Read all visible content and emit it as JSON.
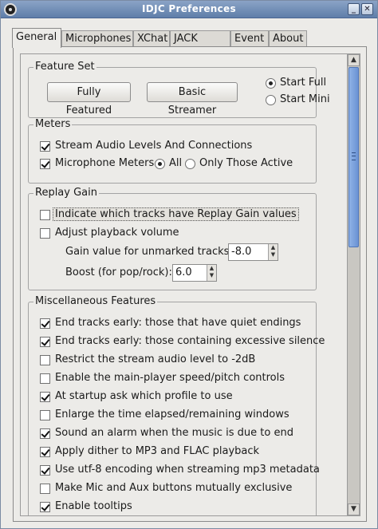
{
  "window": {
    "title": "IDJC Preferences"
  },
  "tabs": [
    {
      "label": "General",
      "active": true
    },
    {
      "label": "Microphones"
    },
    {
      "label": "XChat"
    },
    {
      "label": "JACK Ports"
    },
    {
      "label": "Event"
    },
    {
      "label": "About"
    }
  ],
  "feature_set": {
    "title": "Feature Set",
    "fully_featured": "Fully Featured",
    "basic_streamer": "Basic Streamer",
    "start_full": "Start Full",
    "start_mini": "Start Mini",
    "selected": "Start Full"
  },
  "meters": {
    "title": "Meters",
    "stream_levels": "Stream Audio Levels And Connections",
    "mic_meters": "Microphone Meters",
    "all": "All",
    "only_active": "Only Those Active"
  },
  "replay_gain": {
    "title": "Replay Gain",
    "indicate": "Indicate which tracks have Replay Gain values",
    "adjust": "Adjust playback volume",
    "gain_label": "Gain value for unmarked tracks:",
    "gain_value": "-8.0",
    "boost_label": "Boost (for pop/rock):",
    "boost_value": "6.0"
  },
  "misc": {
    "title": "Miscellaneous Features",
    "items": [
      {
        "label": "End tracks early: those that have quiet endings",
        "checked": true
      },
      {
        "label": "End tracks early: those containing excessive silence",
        "checked": true
      },
      {
        "label": "Restrict the stream audio level to -2dB",
        "checked": false
      },
      {
        "label": "Enable the main-player speed/pitch controls",
        "checked": false
      },
      {
        "label": "At startup ask which profile to use",
        "checked": true
      },
      {
        "label": "Enlarge the time elapsed/remaining windows",
        "checked": false
      },
      {
        "label": "Sound an alarm when the music is due to end",
        "checked": true
      },
      {
        "label": "Apply dither to MP3 and FLAC playback",
        "checked": true
      },
      {
        "label": "Use utf-8 encoding when streaming mp3 metadata",
        "checked": true
      },
      {
        "label": "Make Mic and Aux buttons mutually exclusive",
        "checked": false
      },
      {
        "label": "Enable tooltips",
        "checked": true
      }
    ]
  },
  "scrollbar": {
    "position": 0.0
  }
}
